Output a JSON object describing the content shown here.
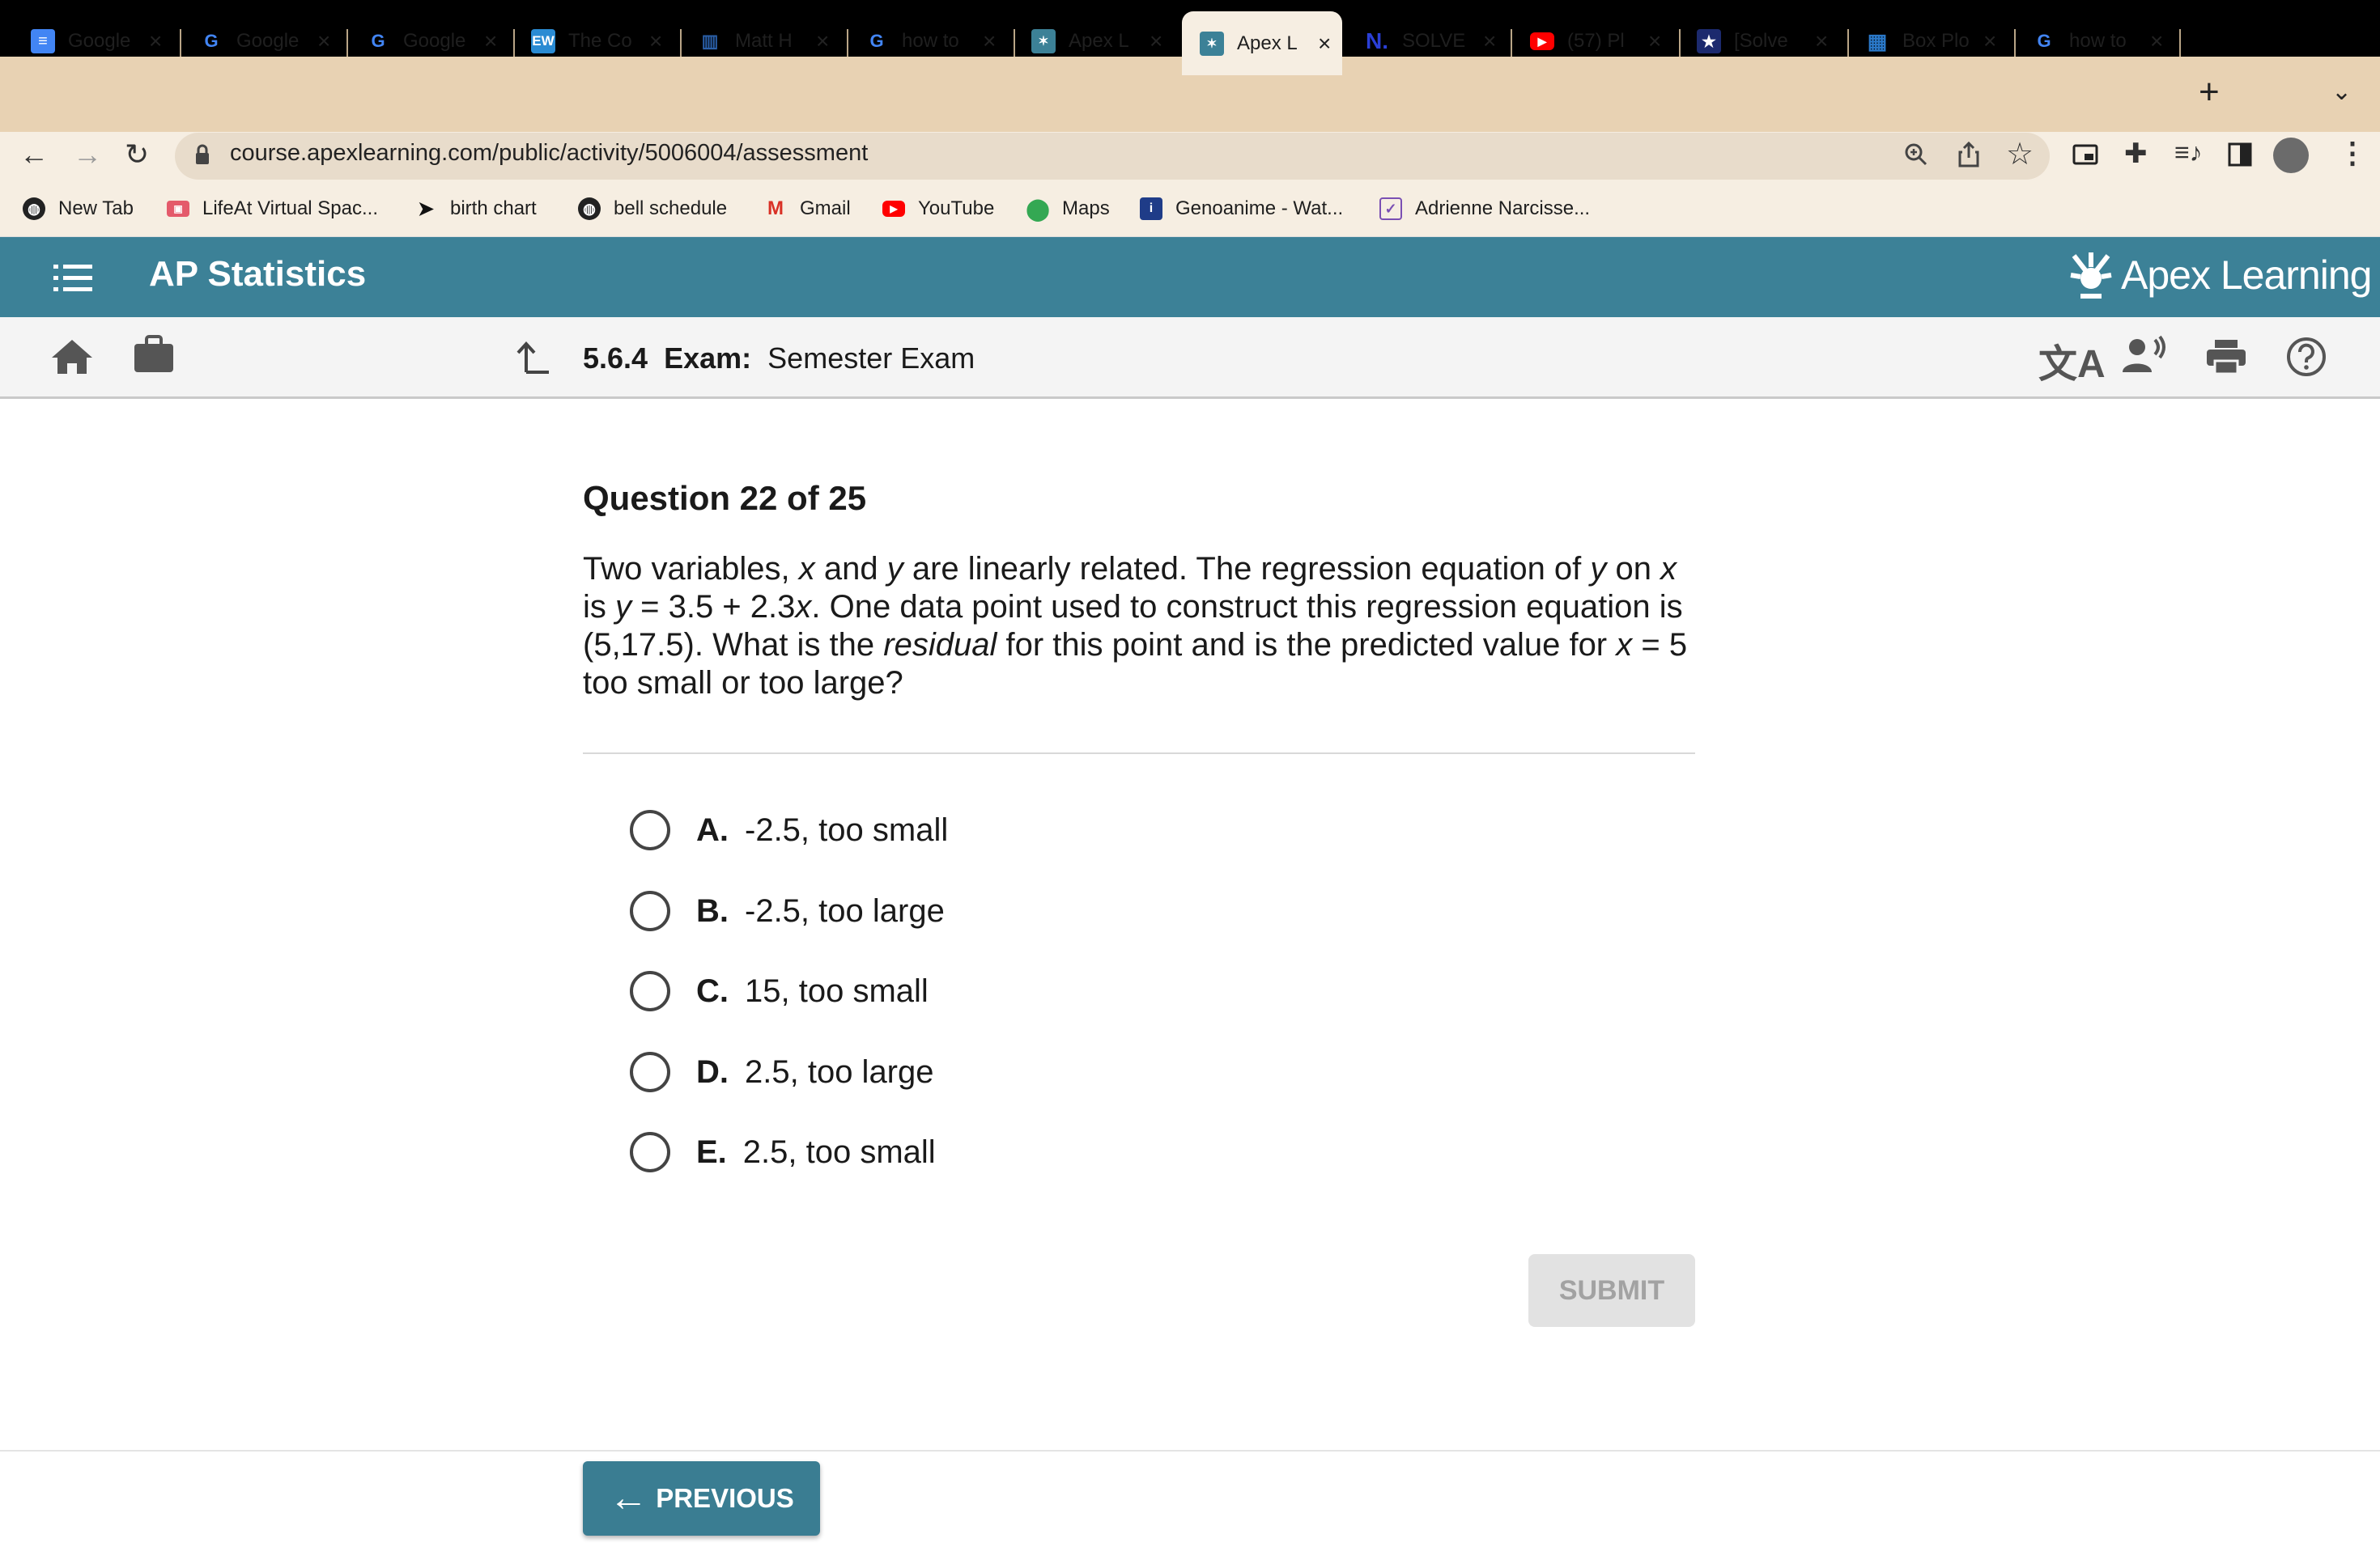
{
  "browser": {
    "tabs": [
      {
        "label": "Google",
        "icon": "google-docs-icon",
        "active": false
      },
      {
        "label": "Google",
        "icon": "google-icon",
        "active": false
      },
      {
        "label": "Google",
        "icon": "google-icon",
        "active": false
      },
      {
        "label": "The Co",
        "icon": "ew-icon",
        "active": false
      },
      {
        "label": "Matt H",
        "icon": "library-icon",
        "active": false
      },
      {
        "label": "how to",
        "icon": "google-icon",
        "active": false
      },
      {
        "label": "Apex L",
        "icon": "apex-icon",
        "active": false
      },
      {
        "label": "Apex L",
        "icon": "apex-icon",
        "active": true
      },
      {
        "label": "SOLVE",
        "icon": "numerade-icon",
        "active": false
      },
      {
        "label": "(57) Pl",
        "icon": "youtube-icon",
        "active": false
      },
      {
        "label": "[Solve",
        "icon": "star-badge-icon",
        "active": false
      },
      {
        "label": "Box Plo",
        "icon": "calculator-icon",
        "active": false
      },
      {
        "label": "how to",
        "icon": "google-icon",
        "active": false
      }
    ],
    "new_tab_symbol": "+",
    "url": "course.apexlearning.com/public/activity/5006004/assessment",
    "bookmarks": [
      {
        "label": "New Tab",
        "icon": "globe-icon"
      },
      {
        "label": "LifeAt Virtual Spac...",
        "icon": "lifeat-icon"
      },
      {
        "label": "birth chart",
        "icon": "bird-icon"
      },
      {
        "label": "bell schedule",
        "icon": "globe-icon"
      },
      {
        "label": "Gmail",
        "icon": "gmail-icon"
      },
      {
        "label": "YouTube",
        "icon": "youtube-icon"
      },
      {
        "label": "Maps",
        "icon": "maps-pin-icon"
      },
      {
        "label": "Genoanime - Wat...",
        "icon": "genoanime-icon"
      },
      {
        "label": "Adrienne Narcisse...",
        "icon": "checkbox-icon"
      }
    ]
  },
  "app": {
    "course_title": "AP Statistics",
    "brand": "Apex Learning",
    "breadcrumb": {
      "number": "5.6.4",
      "type": "Exam:",
      "name": "Semester Exam"
    },
    "accent_color": "#3c8197"
  },
  "question": {
    "header": "Question 22 of 25",
    "text_parts": {
      "p1": "Two variables, ",
      "x1": "x",
      "p2": " and ",
      "y1": "y",
      "p3": " are linearly related. The regression equation of ",
      "y2": "y",
      "p4": " on ",
      "x2": "x",
      "p5": " is ",
      "y3": "y",
      "p6": " = 3.5 + 2.3",
      "x3": "x",
      "p7": ". One data point used to construct this regression equation is (5,17.5). What is the ",
      "residual": "residual",
      "p8": " for this point and is the predicted value for ",
      "x4": "x",
      "p9": " = 5 too small or too large?"
    },
    "options": [
      {
        "letter": "A.",
        "text": "-2.5, too small"
      },
      {
        "letter": "B.",
        "text": "-2.5, too large"
      },
      {
        "letter": "C.",
        "text": "15, too small"
      },
      {
        "letter": "D.",
        "text": "2.5, too large"
      },
      {
        "letter": "E.",
        "text": "2.5, too small"
      }
    ]
  },
  "actions": {
    "submit_label": "SUBMIT",
    "previous_label": "PREVIOUS"
  }
}
